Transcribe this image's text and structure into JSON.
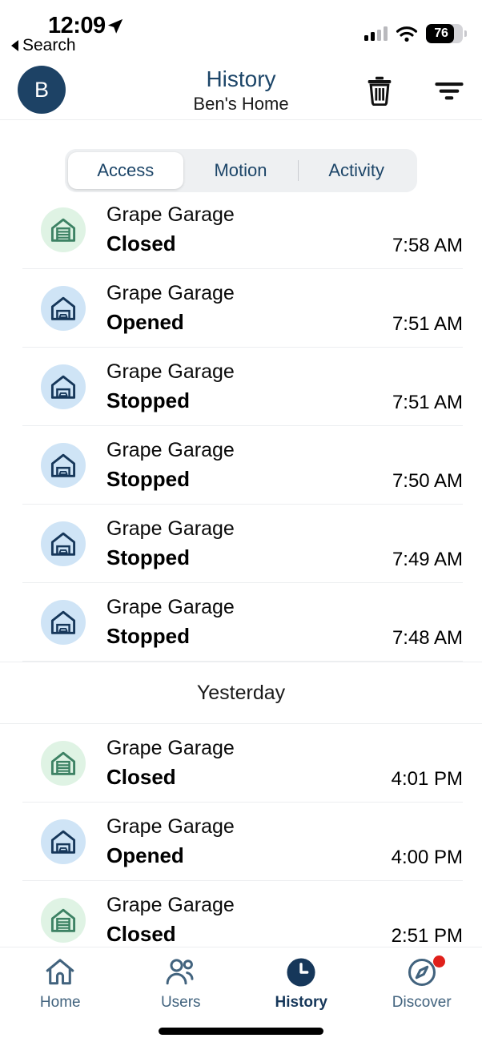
{
  "status_bar": {
    "time": "12:09",
    "back_label": "Search",
    "battery_percent": "76",
    "battery_level": 76,
    "location_icon": "location-arrow-icon",
    "wifi_icon": "wifi-icon",
    "signal_icon": "cellular-signal-icon"
  },
  "header": {
    "avatar_initial": "B",
    "title": "History",
    "subtitle": "Ben's Home",
    "delete_icon": "trash-icon",
    "filter_icon": "filter-icon",
    "title_color": "#1c4568",
    "avatar_color": "#1d4265"
  },
  "segmented": {
    "selected": "Access",
    "options": [
      {
        "label": "Access",
        "active": true
      },
      {
        "label": "Motion",
        "active": false
      },
      {
        "label": "Activity",
        "active": false
      }
    ]
  },
  "list": [
    {
      "kind": "event",
      "device": "Grape Garage",
      "status": "Closed",
      "time": "7:58 AM",
      "icon": "garage-closed-icon",
      "icon_state": "closed",
      "clipped": true
    },
    {
      "kind": "event",
      "device": "Grape Garage",
      "status": "Opened",
      "time": "7:51 AM",
      "icon": "garage-open-car-icon",
      "icon_state": "open"
    },
    {
      "kind": "event",
      "device": "Grape Garage",
      "status": "Stopped",
      "time": "7:51 AM",
      "icon": "garage-open-car-icon",
      "icon_state": "open"
    },
    {
      "kind": "event",
      "device": "Grape Garage",
      "status": "Stopped",
      "time": "7:50 AM",
      "icon": "garage-open-car-icon",
      "icon_state": "open"
    },
    {
      "kind": "event",
      "device": "Grape Garage",
      "status": "Stopped",
      "time": "7:49 AM",
      "icon": "garage-open-car-icon",
      "icon_state": "open"
    },
    {
      "kind": "event",
      "device": "Grape Garage",
      "status": "Stopped",
      "time": "7:48 AM",
      "icon": "garage-open-car-icon",
      "icon_state": "open"
    },
    {
      "kind": "day",
      "label": "Yesterday"
    },
    {
      "kind": "event",
      "device": "Grape Garage",
      "status": "Closed",
      "time": "4:01 PM",
      "icon": "garage-closed-icon",
      "icon_state": "closed"
    },
    {
      "kind": "event",
      "device": "Grape Garage",
      "status": "Opened",
      "time": "4:00 PM",
      "icon": "garage-open-car-icon",
      "icon_state": "open"
    },
    {
      "kind": "event",
      "device": "Grape Garage",
      "status": "Closed",
      "time": "2:51 PM",
      "icon": "garage-closed-icon",
      "icon_state": "closed"
    }
  ],
  "tabs": [
    {
      "label": "Home",
      "icon": "home-icon",
      "active": false,
      "badge": false
    },
    {
      "label": "Users",
      "icon": "users-icon",
      "active": false,
      "badge": false
    },
    {
      "label": "History",
      "icon": "clock-icon",
      "active": true,
      "badge": false
    },
    {
      "label": "Discover",
      "icon": "compass-icon",
      "active": false,
      "badge": true
    }
  ],
  "colors": {
    "brand_navy": "#1c4568",
    "closed_green_bg": "#dff3e4",
    "closed_green_fg": "#3d8264",
    "open_blue_bg": "#cfe4f6",
    "open_blue_fg": "#16375a",
    "badge_red": "#e0201b"
  }
}
